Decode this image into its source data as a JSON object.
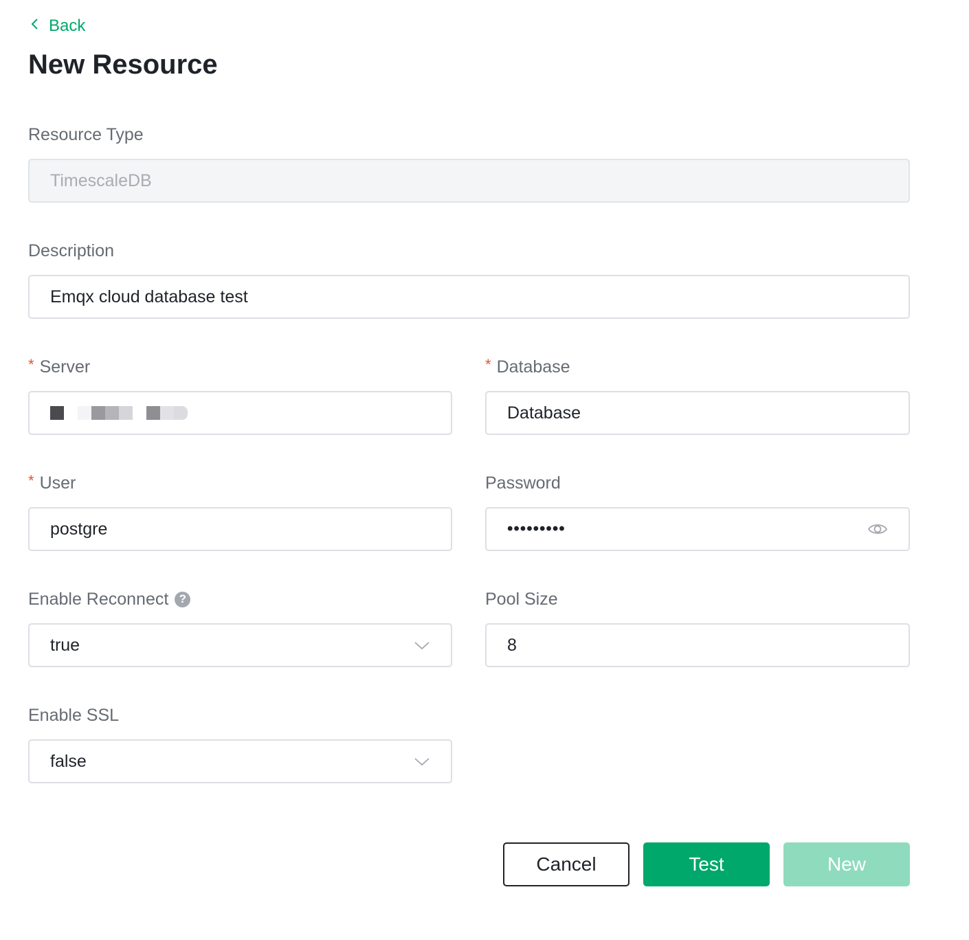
{
  "nav": {
    "back_label": "Back"
  },
  "page": {
    "title": "New Resource"
  },
  "form": {
    "resource_type": {
      "label": "Resource Type",
      "value": "TimescaleDB"
    },
    "description": {
      "label": "Description",
      "value": "Emqx cloud database test"
    },
    "server": {
      "label": "Server",
      "required_mark": "*",
      "value": ""
    },
    "database": {
      "label": "Database",
      "required_mark": "*",
      "value": "Database"
    },
    "user": {
      "label": "User",
      "required_mark": "*",
      "value": "postgre"
    },
    "password": {
      "label": "Password",
      "masked_value": "•••••••••"
    },
    "enable_reconnect": {
      "label": "Enable Reconnect",
      "help_glyph": "?",
      "value": "true"
    },
    "pool_size": {
      "label": "Pool Size",
      "value": "8"
    },
    "enable_ssl": {
      "label": "Enable SSL",
      "value": "false"
    }
  },
  "actions": {
    "cancel_label": "Cancel",
    "test_label": "Test",
    "new_label": "New"
  },
  "colors": {
    "accent": "#00a86b",
    "accent_disabled": "#8fdbbe",
    "required": "#e0562f"
  }
}
